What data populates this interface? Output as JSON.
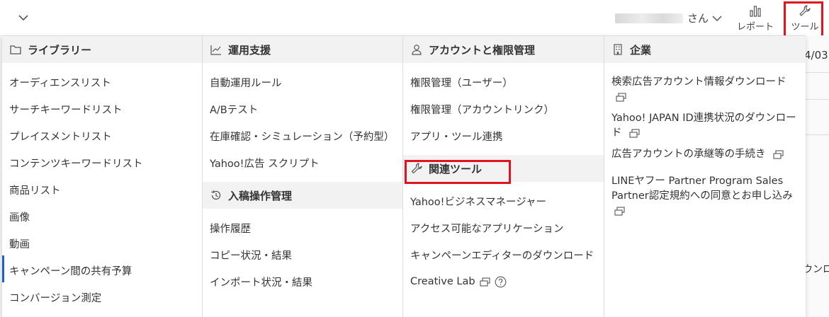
{
  "topbar": {
    "user_suffix": "さん",
    "report_label": "レポート",
    "tool_label": "ツール"
  },
  "columns": {
    "library": {
      "heading": "ライブラリー",
      "items": [
        "オーディエンスリスト",
        "サーチキーワードリスト",
        "プレイスメントリスト",
        "コンテンツキーワードリスト",
        "商品リスト",
        "画像",
        "動画",
        "キャンペーン間の共有予算",
        "コンバージョン測定"
      ]
    },
    "operations": {
      "heading": "運用支援",
      "items": [
        "自動運用ルール",
        "A/Bテスト",
        "在庫確認・シミュレーション（予約型）",
        "Yahoo!広告 スクリプト"
      ]
    },
    "submission": {
      "heading": "入稿操作管理",
      "items": [
        "操作履歴",
        "コピー状況・結果",
        "インポート状況・結果"
      ]
    },
    "account": {
      "heading": "アカウントと権限管理",
      "items": [
        "権限管理（ユーザー）",
        "権限管理（アカウントリンク）",
        "アプリ・ツール連携"
      ]
    },
    "related": {
      "heading": "関連ツール",
      "items": [
        "Yahoo!ビジネスマネージャー",
        "アクセス可能なアプリケーション",
        "キャンペーンエディターのダウンロード",
        "Creative Lab"
      ]
    },
    "company": {
      "heading": "企業",
      "items": [
        "検索広告アカウント情報ダウンロード",
        "Yahoo! JAPAN ID連携状況のダウンロード",
        "広告アカウントの承継等の手続き",
        "LINEヤフー Partner Program Sales Partner認定規約への同意とお申し込み"
      ]
    }
  },
  "background": {
    "date_fragment": "4/03",
    "text_fragment": "ウンロ"
  },
  "colors": {
    "highlight": "#e0141e",
    "active": "#1b62c4"
  }
}
